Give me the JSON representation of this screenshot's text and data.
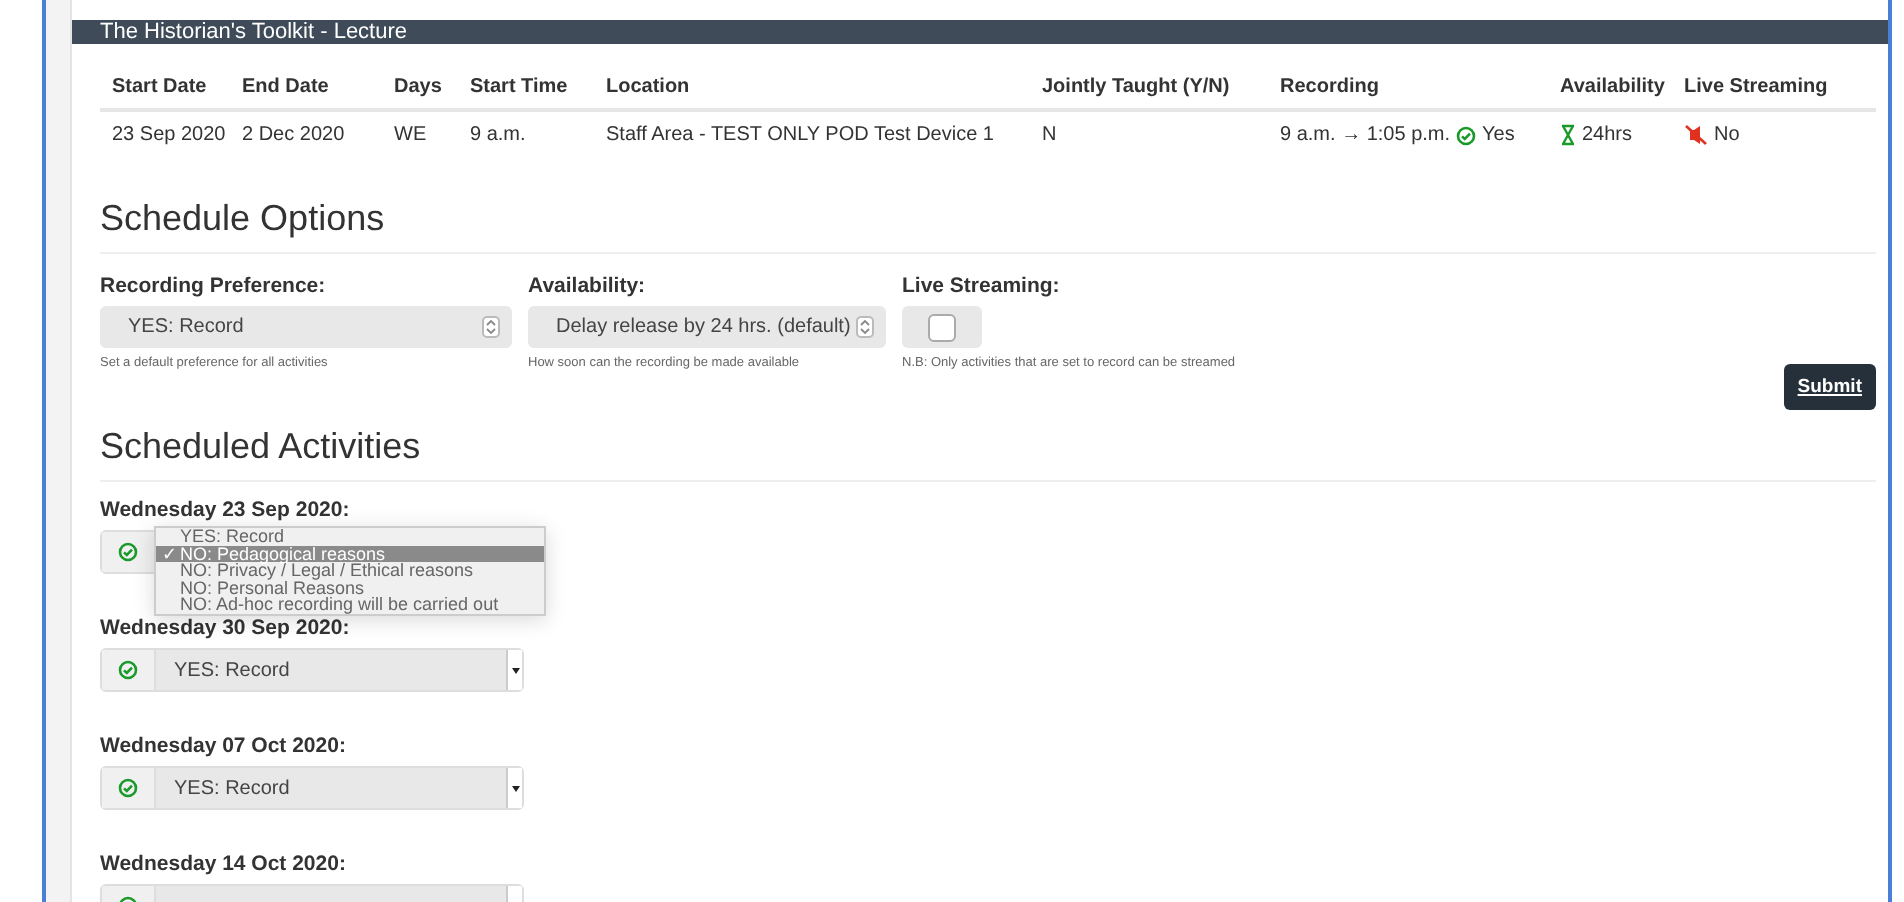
{
  "panel": {
    "title": "The Historian's Toolkit - Lecture"
  },
  "table": {
    "columns": [
      "Start Date",
      "End Date",
      "Days",
      "Start Time",
      "Location",
      "Jointly Taught (Y/N)",
      "Recording",
      "Availability",
      "Live Streaming"
    ],
    "rows": [
      {
        "start_date": "23 Sep 2020",
        "end_date": "2 Dec 2020",
        "days": "WE",
        "start_time": "9 a.m.",
        "location": "Staff Area - TEST ONLY POD Test Device 1",
        "jointly_taught": "N",
        "recording": "9 a.m. → 1:05 p.m.",
        "recording_status": "Yes",
        "availability": "24hrs",
        "live_streaming": "No"
      }
    ]
  },
  "schedule_options": {
    "title": "Schedule Options",
    "recording_preference": {
      "label": "Recording Preference:",
      "value": "YES: Record",
      "help": "Set a default preference for all activities"
    },
    "availability": {
      "label": "Availability:",
      "value": "Delay release by 24 hrs. (default)",
      "help": "How soon can the recording be made available"
    },
    "live_streaming": {
      "label": "Live Streaming:",
      "checked": false,
      "help": "N.B: Only activities that are set to record can be streamed"
    },
    "submit": "Submit"
  },
  "scheduled_activities": {
    "title": "Scheduled Activities",
    "activities": [
      {
        "date": "Wednesday 23 Sep 2020:"
      },
      {
        "date": "Wednesday 30 Sep 2020:",
        "value": "YES: Record"
      },
      {
        "date": "Wednesday 07 Oct 2020:",
        "value": "YES: Record"
      },
      {
        "date": "Wednesday 14 Oct 2020:"
      }
    ],
    "check_glyph": "✓",
    "menu": [
      {
        "label": "YES: Record",
        "selected": false
      },
      {
        "label": "NO: Pedagogical reasons",
        "selected": true
      },
      {
        "label": "NO: Privacy / Legal / Ethical reasons",
        "selected": false
      },
      {
        "label": "NO: Personal Reasons",
        "selected": false
      },
      {
        "label": "NO: Ad-hoc recording will be carried out",
        "selected": false
      }
    ]
  }
}
